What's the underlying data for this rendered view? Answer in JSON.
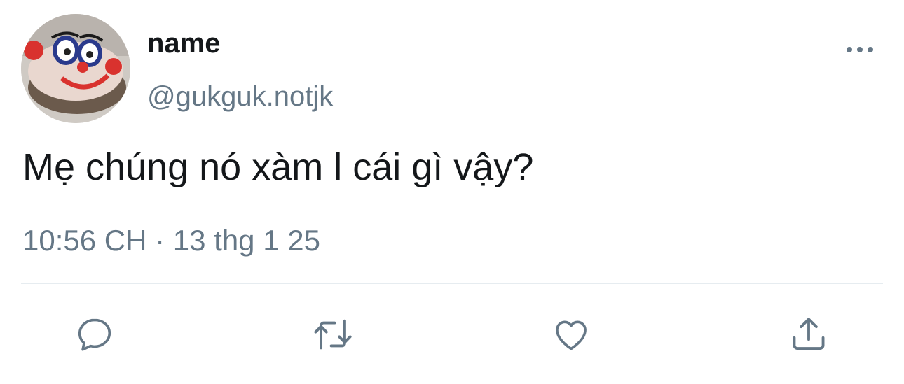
{
  "author": {
    "name": "name",
    "handle": "@gukguk.notjk"
  },
  "tweet": {
    "text": "Mẹ chúng nó xàm l cái gì vậy?",
    "timestamp": "10:56 CH · 13 thg 1 25"
  },
  "icons": {
    "more": "more-options-icon",
    "reply": "reply-icon",
    "retweet": "retweet-icon",
    "like": "heart-icon",
    "share": "share-icon"
  },
  "colors": {
    "text_primary": "#14171a",
    "text_secondary": "#657786",
    "divider": "#e6ecf0"
  }
}
